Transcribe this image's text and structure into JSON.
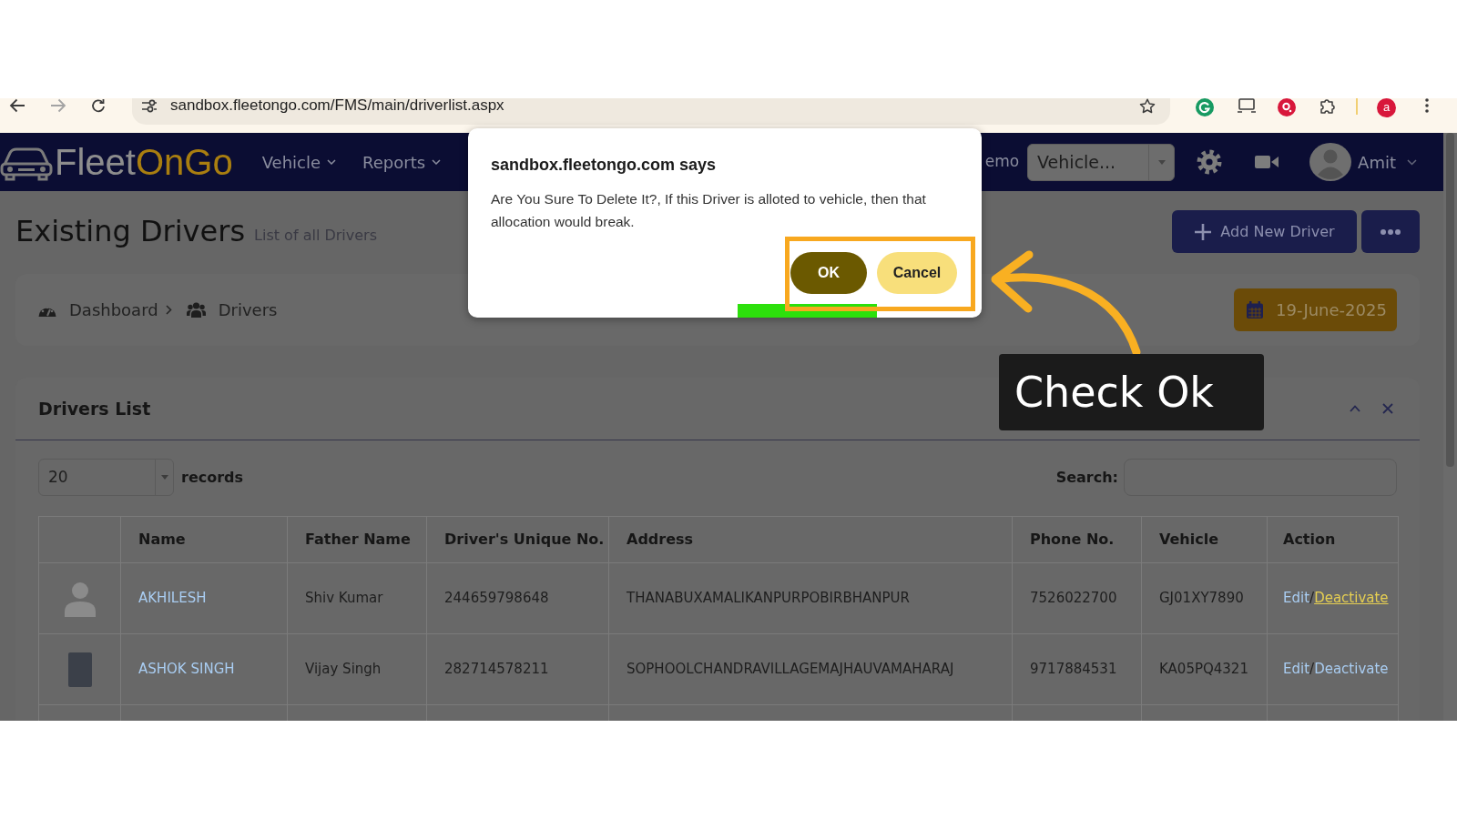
{
  "browser": {
    "url": "sandbox.fleetongo.com/FMS/main/driverlist.aspx",
    "profile_initial": "a"
  },
  "navbar": {
    "brand": [
      {
        "text": "Fleet",
        "kind": "plain"
      },
      {
        "text": "OnGo",
        "kind": "accent"
      }
    ],
    "menus": [
      {
        "label": "Vehicle"
      },
      {
        "label": "Reports"
      }
    ],
    "partial_link": "emo",
    "vehicle_select": {
      "value": "Vehicle..."
    },
    "user_name": "Amit"
  },
  "header": {
    "title": "Existing Drivers",
    "subtitle": "List of all Drivers",
    "add_button": "Add New Driver"
  },
  "breadcrumb": [
    {
      "label": "Dashboard",
      "kind": "dashboard"
    },
    {
      "label": "Drivers",
      "kind": "users"
    }
  ],
  "date_button": "19-June-2025",
  "drivers_list": {
    "title": "Drivers List",
    "page_size": "20",
    "records_label": "records",
    "search_label": "Search:",
    "table": {
      "columns": [
        "Name",
        "Father Name",
        "Driver's Unique No.",
        "Address",
        "Phone No.",
        "Vehicle",
        "Action"
      ],
      "rows": [
        {
          "kind": "avatar",
          "name": "AKHILESH",
          "father_name": "Shiv Kumar",
          "unique_no": "244659798648",
          "address": "THANABUXAMALIKANPURPOBIRBHANPUR",
          "phone": "7526022700",
          "vehicle": "GJ01XY7890",
          "edit": "Edit",
          "separator": "/",
          "deactivate": "Deactivate",
          "deactivate_hovered": true
        },
        {
          "kind": "photo",
          "name": "ASHOK SINGH",
          "father_name": "Vijay Singh",
          "unique_no": "282714578211",
          "address": "SOPHOOLCHANDRAVILLAGEMAJHAUVAMAHARAJ",
          "phone": "9717884531",
          "vehicle": "KA05PQ4321",
          "edit": "Edit",
          "separator": "/",
          "deactivate": "Deactivate",
          "deactivate_hovered": false
        }
      ]
    }
  },
  "dialog": {
    "title": "sandbox.fleetongo.com says",
    "message": "Are You Sure To Delete It?, If this Driver is alloted to vehicle, then that allocation would break.",
    "buttons": [
      {
        "label": "OK",
        "kind": "primary"
      },
      {
        "label": "Cancel",
        "kind": "secondary"
      }
    ]
  },
  "annotation": {
    "callout": "Check Ok"
  }
}
